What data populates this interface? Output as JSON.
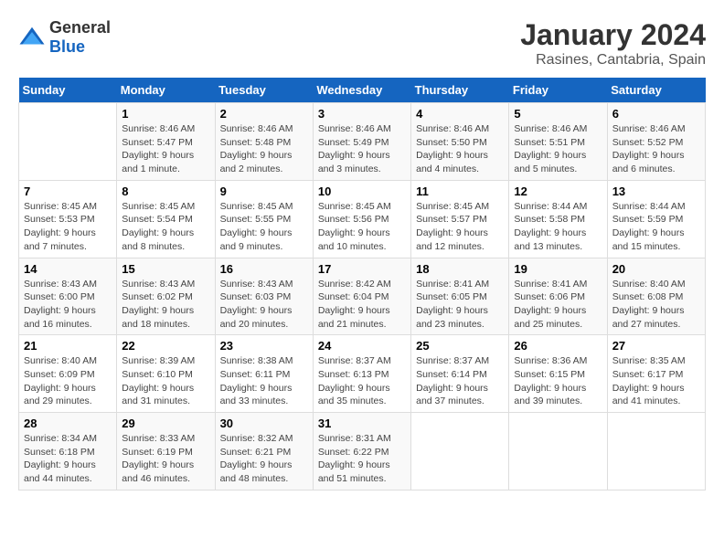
{
  "logo": {
    "general": "General",
    "blue": "Blue"
  },
  "title": "January 2024",
  "subtitle": "Rasines, Cantabria, Spain",
  "days_of_week": [
    "Sunday",
    "Monday",
    "Tuesday",
    "Wednesday",
    "Thursday",
    "Friday",
    "Saturday"
  ],
  "weeks": [
    [
      {
        "num": "",
        "sunrise": "",
        "sunset": "",
        "daylight": ""
      },
      {
        "num": "1",
        "sunrise": "Sunrise: 8:46 AM",
        "sunset": "Sunset: 5:47 PM",
        "daylight": "Daylight: 9 hours and 1 minute."
      },
      {
        "num": "2",
        "sunrise": "Sunrise: 8:46 AM",
        "sunset": "Sunset: 5:48 PM",
        "daylight": "Daylight: 9 hours and 2 minutes."
      },
      {
        "num": "3",
        "sunrise": "Sunrise: 8:46 AM",
        "sunset": "Sunset: 5:49 PM",
        "daylight": "Daylight: 9 hours and 3 minutes."
      },
      {
        "num": "4",
        "sunrise": "Sunrise: 8:46 AM",
        "sunset": "Sunset: 5:50 PM",
        "daylight": "Daylight: 9 hours and 4 minutes."
      },
      {
        "num": "5",
        "sunrise": "Sunrise: 8:46 AM",
        "sunset": "Sunset: 5:51 PM",
        "daylight": "Daylight: 9 hours and 5 minutes."
      },
      {
        "num": "6",
        "sunrise": "Sunrise: 8:46 AM",
        "sunset": "Sunset: 5:52 PM",
        "daylight": "Daylight: 9 hours and 6 minutes."
      }
    ],
    [
      {
        "num": "7",
        "sunrise": "Sunrise: 8:45 AM",
        "sunset": "Sunset: 5:53 PM",
        "daylight": "Daylight: 9 hours and 7 minutes."
      },
      {
        "num": "8",
        "sunrise": "Sunrise: 8:45 AM",
        "sunset": "Sunset: 5:54 PM",
        "daylight": "Daylight: 9 hours and 8 minutes."
      },
      {
        "num": "9",
        "sunrise": "Sunrise: 8:45 AM",
        "sunset": "Sunset: 5:55 PM",
        "daylight": "Daylight: 9 hours and 9 minutes."
      },
      {
        "num": "10",
        "sunrise": "Sunrise: 8:45 AM",
        "sunset": "Sunset: 5:56 PM",
        "daylight": "Daylight: 9 hours and 10 minutes."
      },
      {
        "num": "11",
        "sunrise": "Sunrise: 8:45 AM",
        "sunset": "Sunset: 5:57 PM",
        "daylight": "Daylight: 9 hours and 12 minutes."
      },
      {
        "num": "12",
        "sunrise": "Sunrise: 8:44 AM",
        "sunset": "Sunset: 5:58 PM",
        "daylight": "Daylight: 9 hours and 13 minutes."
      },
      {
        "num": "13",
        "sunrise": "Sunrise: 8:44 AM",
        "sunset": "Sunset: 5:59 PM",
        "daylight": "Daylight: 9 hours and 15 minutes."
      }
    ],
    [
      {
        "num": "14",
        "sunrise": "Sunrise: 8:43 AM",
        "sunset": "Sunset: 6:00 PM",
        "daylight": "Daylight: 9 hours and 16 minutes."
      },
      {
        "num": "15",
        "sunrise": "Sunrise: 8:43 AM",
        "sunset": "Sunset: 6:02 PM",
        "daylight": "Daylight: 9 hours and 18 minutes."
      },
      {
        "num": "16",
        "sunrise": "Sunrise: 8:43 AM",
        "sunset": "Sunset: 6:03 PM",
        "daylight": "Daylight: 9 hours and 20 minutes."
      },
      {
        "num": "17",
        "sunrise": "Sunrise: 8:42 AM",
        "sunset": "Sunset: 6:04 PM",
        "daylight": "Daylight: 9 hours and 21 minutes."
      },
      {
        "num": "18",
        "sunrise": "Sunrise: 8:41 AM",
        "sunset": "Sunset: 6:05 PM",
        "daylight": "Daylight: 9 hours and 23 minutes."
      },
      {
        "num": "19",
        "sunrise": "Sunrise: 8:41 AM",
        "sunset": "Sunset: 6:06 PM",
        "daylight": "Daylight: 9 hours and 25 minutes."
      },
      {
        "num": "20",
        "sunrise": "Sunrise: 8:40 AM",
        "sunset": "Sunset: 6:08 PM",
        "daylight": "Daylight: 9 hours and 27 minutes."
      }
    ],
    [
      {
        "num": "21",
        "sunrise": "Sunrise: 8:40 AM",
        "sunset": "Sunset: 6:09 PM",
        "daylight": "Daylight: 9 hours and 29 minutes."
      },
      {
        "num": "22",
        "sunrise": "Sunrise: 8:39 AM",
        "sunset": "Sunset: 6:10 PM",
        "daylight": "Daylight: 9 hours and 31 minutes."
      },
      {
        "num": "23",
        "sunrise": "Sunrise: 8:38 AM",
        "sunset": "Sunset: 6:11 PM",
        "daylight": "Daylight: 9 hours and 33 minutes."
      },
      {
        "num": "24",
        "sunrise": "Sunrise: 8:37 AM",
        "sunset": "Sunset: 6:13 PM",
        "daylight": "Daylight: 9 hours and 35 minutes."
      },
      {
        "num": "25",
        "sunrise": "Sunrise: 8:37 AM",
        "sunset": "Sunset: 6:14 PM",
        "daylight": "Daylight: 9 hours and 37 minutes."
      },
      {
        "num": "26",
        "sunrise": "Sunrise: 8:36 AM",
        "sunset": "Sunset: 6:15 PM",
        "daylight": "Daylight: 9 hours and 39 minutes."
      },
      {
        "num": "27",
        "sunrise": "Sunrise: 8:35 AM",
        "sunset": "Sunset: 6:17 PM",
        "daylight": "Daylight: 9 hours and 41 minutes."
      }
    ],
    [
      {
        "num": "28",
        "sunrise": "Sunrise: 8:34 AM",
        "sunset": "Sunset: 6:18 PM",
        "daylight": "Daylight: 9 hours and 44 minutes."
      },
      {
        "num": "29",
        "sunrise": "Sunrise: 8:33 AM",
        "sunset": "Sunset: 6:19 PM",
        "daylight": "Daylight: 9 hours and 46 minutes."
      },
      {
        "num": "30",
        "sunrise": "Sunrise: 8:32 AM",
        "sunset": "Sunset: 6:21 PM",
        "daylight": "Daylight: 9 hours and 48 minutes."
      },
      {
        "num": "31",
        "sunrise": "Sunrise: 8:31 AM",
        "sunset": "Sunset: 6:22 PM",
        "daylight": "Daylight: 9 hours and 51 minutes."
      },
      {
        "num": "",
        "sunrise": "",
        "sunset": "",
        "daylight": ""
      },
      {
        "num": "",
        "sunrise": "",
        "sunset": "",
        "daylight": ""
      },
      {
        "num": "",
        "sunrise": "",
        "sunset": "",
        "daylight": ""
      }
    ]
  ]
}
